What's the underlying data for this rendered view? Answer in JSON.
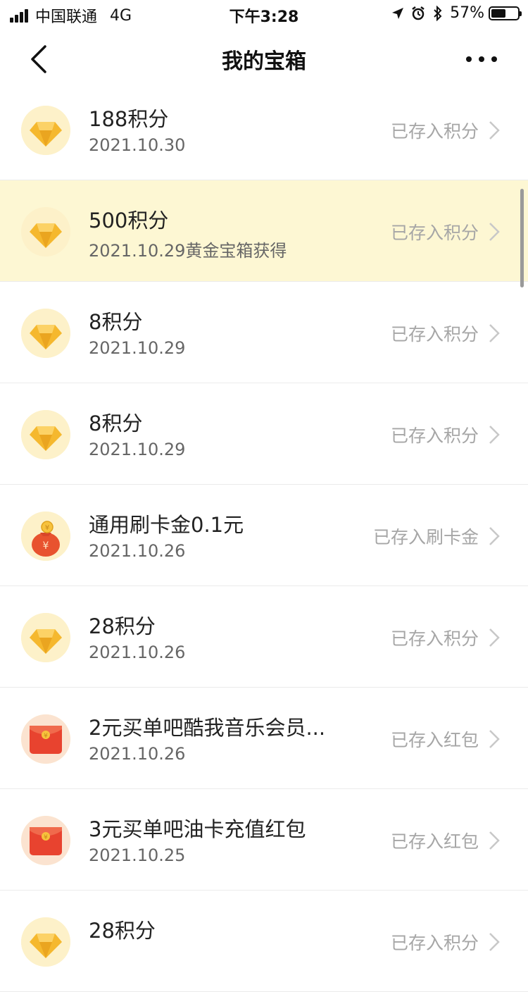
{
  "status_bar": {
    "carrier": "中国联通",
    "network": "4G",
    "time": "下午3:28",
    "battery_pct": "57%"
  },
  "nav": {
    "title": "我的宝箱"
  },
  "items": [
    {
      "title": "188积分",
      "date": "2021.10.30",
      "status": "已存入积分",
      "icon": "diamond-icon"
    },
    {
      "title": "500积分",
      "date": "2021.10.29黄金宝箱获得",
      "status": "已存入积分",
      "icon": "diamond-icon"
    },
    {
      "title": "8积分",
      "date": "2021.10.29",
      "status": "已存入积分",
      "icon": "diamond-icon"
    },
    {
      "title": "8积分",
      "date": "2021.10.29",
      "status": "已存入积分",
      "icon": "diamond-icon"
    },
    {
      "title": "通用刷卡金0.1元",
      "date": "2021.10.26",
      "status": "已存入刷卡金",
      "icon": "money-bag-icon"
    },
    {
      "title": "28积分",
      "date": "2021.10.26",
      "status": "已存入积分",
      "icon": "diamond-icon"
    },
    {
      "title": "2元买单吧酷我音乐会员...",
      "date": "2021.10.26",
      "status": "已存入红包",
      "icon": "red-envelope-icon"
    },
    {
      "title": "3元买单吧油卡充值红包",
      "date": "2021.10.25",
      "status": "已存入红包",
      "icon": "red-envelope-icon"
    },
    {
      "title": "28积分",
      "date": "",
      "status": "已存入积分",
      "icon": "diamond-icon"
    }
  ],
  "colors": {
    "highlight_row": "#fdf7d3",
    "diamond_gold": "#f5b82e",
    "envelope_red": "#e8432f"
  }
}
